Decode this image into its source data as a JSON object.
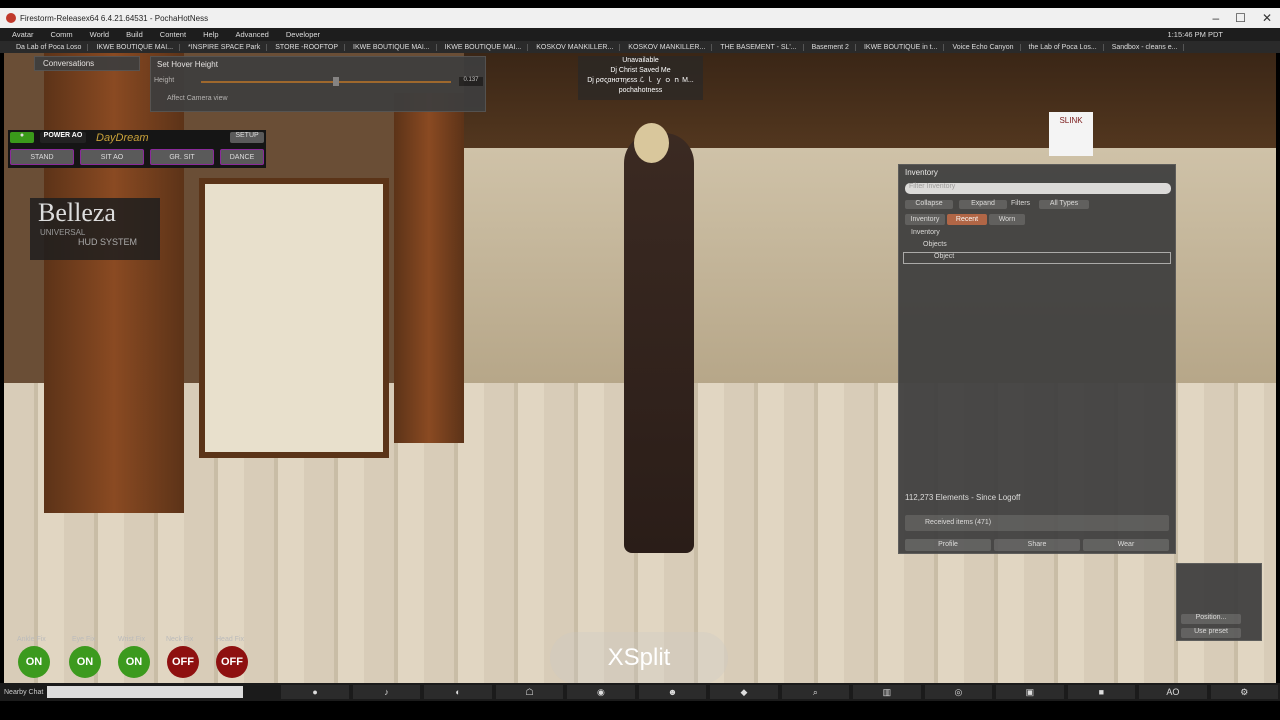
{
  "window": {
    "title": "Firestorm-Releasex64 6.4.21.64531 - PochaHotNess"
  },
  "menu": {
    "items": [
      "Avatar",
      "Comm",
      "World",
      "Build",
      "Content",
      "Help",
      "Advanced",
      "Developer"
    ],
    "clock": "1:15:46 PM PDT"
  },
  "favorites": [
    "Da Lab of Poca Loso",
    "IKWE BOUTIQUE MAI...",
    "*INSPIRE SPACE Park",
    "STORE -ROOFTOP",
    "IKWE BOUTIQUE MAI...",
    "IKWE BOUTIQUE MAI...",
    "KOSKOV MANKILLER...",
    "KOSKOV MANKILLER...",
    "THE BASEMENT - SL'...",
    "Basement 2",
    "IKWE BOUTIQUE in t...",
    "Voice Echo Canyon",
    "the Lab of Poca Los...",
    "Sandbox - cleans e..."
  ],
  "conversations": {
    "label": "Conversations"
  },
  "hover": {
    "title": "Set Hover Height",
    "height_label": "Height",
    "value": "0.137",
    "affect": "Affect Camera view"
  },
  "nametag": {
    "line1": "Unavailable",
    "line2": "Dj Christ Saved Me",
    "line3": "Dj ρσς̧αнσтηєѕѕ ℒ ｌ ｙ ｏ ｎ M...",
    "line4": "pochahotness"
  },
  "ao": {
    "power": "POWER AO",
    "brand": "DayDream",
    "setup": "SETUP",
    "stand": "STAND",
    "sit": "SIT AO",
    "gr": "GR. SIT",
    "dance": "DANCE"
  },
  "belleza": {
    "title": "Belleza",
    "sub1": "UNIVERSAL",
    "sub2": "HUD SYSTEM"
  },
  "slink": {
    "label": "SLINK"
  },
  "inventory": {
    "title": "Inventory",
    "filter_placeholder": "Filter Inventory",
    "collapse": "Collapse",
    "expand": "Expand",
    "filters": "Filters",
    "types": "All Types",
    "tabs": [
      "Inventory",
      "Recent",
      "Worn"
    ],
    "tree": [
      "Inventory",
      "Objects",
      "Object"
    ],
    "count": "112,273 Elements - Since Logoff",
    "received": "Received items (471)",
    "profile": "Profile",
    "share": "Share",
    "wear": "Wear"
  },
  "fx": {
    "labels": [
      "Ankle Fix",
      "Eye Fix",
      "Wrist Fix",
      "Neck Fix",
      "Head Fix"
    ],
    "states": [
      "ON",
      "ON",
      "ON",
      "OFF",
      "OFF"
    ]
  },
  "camera": {
    "position": "Position...",
    "preset": "Use preset"
  },
  "chat": {
    "label": "Nearby Chat"
  },
  "xsplit": {
    "label": "XSplit"
  },
  "colors": {
    "on": "#3c9a1e",
    "off": "#8e1010",
    "accent": "#b08a3a"
  }
}
